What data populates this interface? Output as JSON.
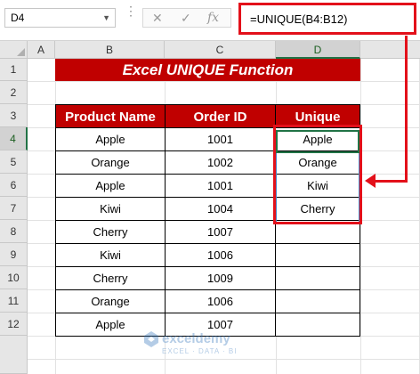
{
  "formula_bar": {
    "name_box": "D4",
    "formula": "=UNIQUE(B4:B12)"
  },
  "icons": {
    "cancel": "✕",
    "enter": "✓",
    "fx": "fx"
  },
  "columns": [
    "A",
    "B",
    "C",
    "D"
  ],
  "rows": [
    "1",
    "2",
    "3",
    "4",
    "5",
    "6",
    "7",
    "8",
    "9",
    "10",
    "11",
    "12"
  ],
  "sheet": {
    "title": "Excel UNIQUE Function",
    "headers": [
      "Product Name",
      "Order ID",
      "Unique"
    ],
    "product_names": [
      "Apple",
      "Orange",
      "Apple",
      "Kiwi",
      "Cherry",
      "Kiwi",
      "Cherry",
      "Orange",
      "Apple"
    ],
    "order_ids": [
      "1001",
      "1002",
      "1001",
      "1004",
      "1007",
      "1006",
      "1009",
      "1006",
      "1007"
    ],
    "unique": [
      "Apple",
      "Orange",
      "Kiwi",
      "Cherry",
      "",
      "",
      "",
      "",
      ""
    ]
  },
  "watermark": {
    "name": "exceldemy",
    "tagline": "EXCEL · DATA · BI"
  },
  "colors": {
    "header_red": "#c00000",
    "highlight_red": "#e3101a",
    "selection_green": "#217346"
  }
}
